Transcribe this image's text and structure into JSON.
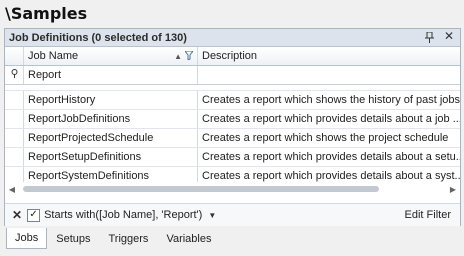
{
  "title": "\\Samples",
  "panel": {
    "title": "Job Definitions (0 selected of 130)",
    "pin_icon": "pin-icon",
    "close_icon": "close-icon"
  },
  "grid": {
    "columns": [
      "Job Name",
      "Description"
    ],
    "filter_value": "Report",
    "rows": [
      {
        "name": "ReportHistory",
        "description": "Creates a report which shows the history of past jobs"
      },
      {
        "name": "ReportJobDefinitions",
        "description": "Creates a report which provides details about a job ..."
      },
      {
        "name": "ReportProjectedSchedule",
        "description": "Creates a report which shows the project schedule"
      },
      {
        "name": "ReportSetupDefinitions",
        "description": "Creates a report which provides details about a setu..."
      },
      {
        "name": "ReportSystemDefinitions",
        "description": "Creates a report which provides details about a syst..."
      }
    ]
  },
  "filter_bar": {
    "text": "Starts with([Job Name], 'Report')",
    "checked": true,
    "edit_label": "Edit Filter"
  },
  "tabs": [
    "Jobs",
    "Setups",
    "Triggers",
    "Variables"
  ],
  "active_tab": "Jobs",
  "colors": {
    "header_bg": "#dde3ec",
    "border": "#aab4c2"
  }
}
